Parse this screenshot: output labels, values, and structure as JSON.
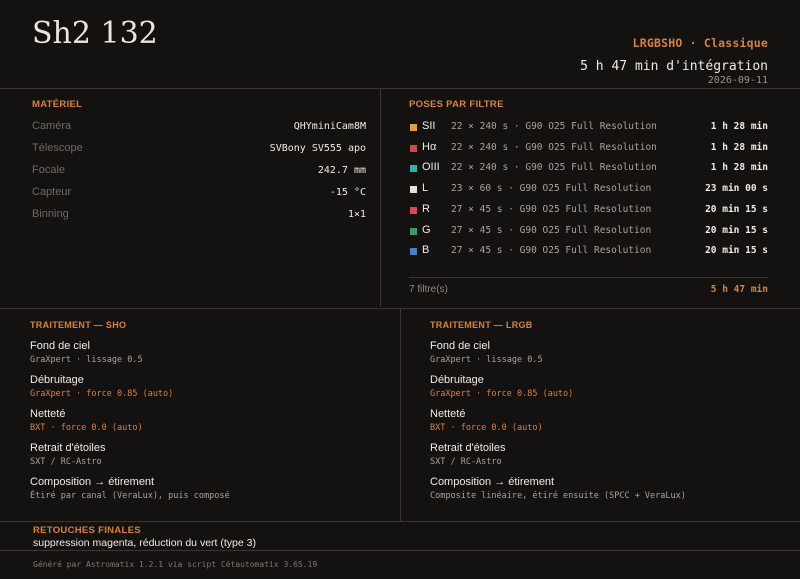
{
  "header": {
    "title": "Sh2 132",
    "subtitle": "LRGBSHO · Classique",
    "integration": "5 h 47 min d'intégration",
    "date": "2026-09-11"
  },
  "equipment": {
    "heading": "MATÉRIEL",
    "rows": [
      {
        "label": "Caméra",
        "value": "QHYminiCam8M"
      },
      {
        "label": "Télescope",
        "value": "SVBony SV555 apo"
      },
      {
        "label": "Focale",
        "value": "242.7 mm"
      },
      {
        "label": "Capteur",
        "value": "-15 °C"
      },
      {
        "label": "Binning",
        "value": "1×1"
      }
    ]
  },
  "filters": {
    "heading": "POSES PAR FILTRE",
    "rows": [
      {
        "name": "SII",
        "color": "#e0a03a",
        "desc": "22 × 240 s · G90 O25 Full Resolution",
        "duration": "1 h 28 min"
      },
      {
        "name": "Hα",
        "color": "#d64545",
        "desc": "22 × 240 s · G90 O25 Full Resolution",
        "duration": "1 h 28 min"
      },
      {
        "name": "OIII",
        "color": "#2fb3a8",
        "desc": "22 × 240 s · G90 O25 Full Resolution",
        "duration": "1 h 28 min"
      },
      {
        "name": "L",
        "color": "#e8e0cc",
        "desc": "23 × 60 s · G90 O25 Full Resolution",
        "duration": "23 min 00 s"
      },
      {
        "name": "R",
        "color": "#d9465a",
        "desc": "27 × 45 s · G90 O25 Full Resolution",
        "duration": "20 min 15 s"
      },
      {
        "name": "G",
        "color": "#3f9a5e",
        "desc": "27 × 45 s · G90 O25 Full Resolution",
        "duration": "20 min 15 s"
      },
      {
        "name": "B",
        "color": "#4b7fc4",
        "desc": "27 × 45 s · G90 O25 Full Resolution",
        "duration": "20 min 15 s"
      }
    ],
    "count": "7 filtre(s)",
    "total": "5 h 47 min"
  },
  "processing": {
    "sho": {
      "heading": "TRAITEMENT — SHO",
      "steps": [
        {
          "name": "Fond de ciel",
          "detail": "GraXpert · lissage 0.5",
          "auto": false
        },
        {
          "name": "Débruitage",
          "detail": "GraXpert · force 0.85 (auto)",
          "auto": true
        },
        {
          "name": "Netteté",
          "detail": "BXT · force 0.0 (auto)",
          "auto": true
        },
        {
          "name": "Retrait d'étoiles",
          "detail": "SXT / RC-Astro",
          "auto": false
        },
        {
          "name": "Composition → étirement",
          "detail": "Étiré par canal (VeraLux), puis composé",
          "auto": false
        }
      ]
    },
    "lrgb": {
      "heading": "TRAITEMENT — LRGB",
      "steps": [
        {
          "name": "Fond de ciel",
          "detail": "GraXpert · lissage 0.5",
          "auto": false
        },
        {
          "name": "Débruitage",
          "detail": "GraXpert · force 0.85 (auto)",
          "auto": true
        },
        {
          "name": "Netteté",
          "detail": "BXT · force 0.0 (auto)",
          "auto": true
        },
        {
          "name": "Retrait d'étoiles",
          "detail": "SXT / RC-Astro",
          "auto": false
        },
        {
          "name": "Composition → étirement",
          "detail": "Composite linéaire, étiré ensuite (SPCC + VeraLux)",
          "auto": false
        }
      ]
    }
  },
  "retouches": {
    "heading": "RETOUCHES FINALES",
    "text": "suppression magenta, réduction du vert (type 3)"
  },
  "footer": "Généré par Astromatix 1.2.1 via script Cétautomatix 3.65.19",
  "colors": {
    "accent": "#d9823b",
    "background": "#141210"
  }
}
